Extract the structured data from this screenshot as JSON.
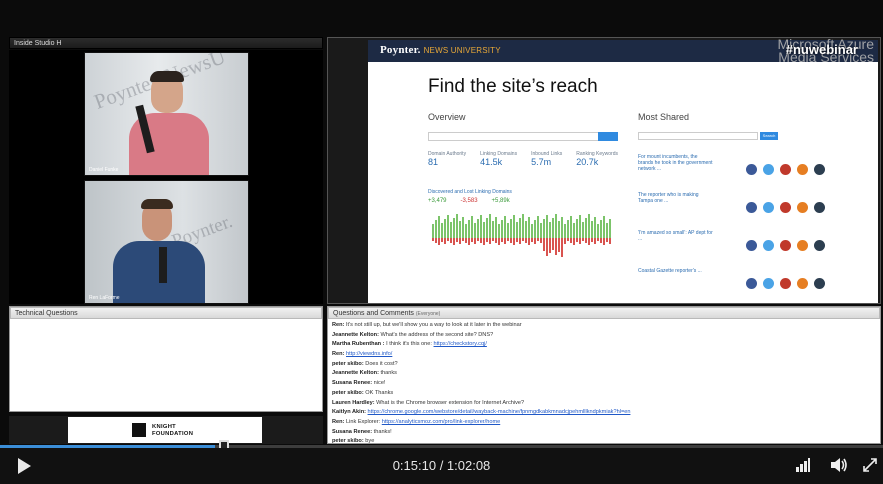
{
  "top_panel": {
    "title": "Inside Studio H"
  },
  "cams": [
    {
      "name": "Daniel Funke",
      "backdrop": "Poynter. NewsU"
    },
    {
      "name": "Ren LaForme",
      "backdrop": "Poynter."
    }
  ],
  "slide": {
    "brand": "Poynter.",
    "brand_sub": "NEWS UNIVERSITY",
    "title": "Find the site’s reach",
    "hashtag": "#nuwebinar",
    "watermark": "Microsoft Azure Media Services",
    "overview": {
      "heading": "Overview",
      "stats": [
        {
          "label": "Domain Authority",
          "value": "81"
        },
        {
          "label": "Linking Domains",
          "value": "41.5k"
        },
        {
          "label": "Inbound Links",
          "value": "5.7m"
        },
        {
          "label": "Ranking Keywords",
          "value": "20.7k"
        }
      ],
      "chart_title": "Discovered and Lost Linking Domains",
      "deltas": [
        "+3,479",
        "-3,583",
        "+5,89k"
      ]
    },
    "most_shared": {
      "heading": "Most Shared",
      "search_btn": "Search",
      "items": [
        "For mount incumbents, the brands he took in the government network ...",
        "The reporter who is making Tampa one ...",
        "'I'm amazed so small': AP dept for ...",
        "Coastal Gazette reporter's ..."
      ]
    }
  },
  "tech_panel": {
    "title": "Technical Questions"
  },
  "knight": {
    "line1": "KNIGHT",
    "line2": "FOUNDATION"
  },
  "questions_panel": {
    "title": "Questions and Comments",
    "filter": "(Everyone)",
    "messages": [
      {
        "author": "Ren:",
        "text": "It's not still up, but we'll show you a way to look at it later in the webinar",
        "link": ""
      },
      {
        "author": "Jeannette Kelton:",
        "text": "What's the address of the second site?  DNS?",
        "link": ""
      },
      {
        "author": "Martha Rubenthan :",
        "text": "I think it's this one:",
        "link": "https://checkstory.cqj/"
      },
      {
        "author": "Ren:",
        "text": "",
        "link": "http://viewdns.info/"
      },
      {
        "author": "peter skibo:",
        "text": "Does it cost?",
        "link": ""
      },
      {
        "author": "Jeannette Kelton:",
        "text": "thanks",
        "link": ""
      },
      {
        "author": "Susana Renee:",
        "text": "nice!",
        "link": ""
      },
      {
        "author": "peter skibo:",
        "text": "OK Thanks",
        "link": ""
      },
      {
        "author": "Lauren Hardley:",
        "text": "What is the Chrome browser extension for Internet Archive?",
        "link": ""
      },
      {
        "author": "Kaitlyn Akin:",
        "text": "",
        "link": "https://chrome.google.com/webstore/detail/wayback-machine/fpnmgdkabkmnadcjpehmlllkndpkmiak?hl=en"
      },
      {
        "author": "Ren:",
        "text": "Link Explorer:",
        "link": "https://analyticsmoz.com/pro/link-explorer/home"
      },
      {
        "author": "Susana Renee:",
        "text": "thanks!",
        "link": ""
      },
      {
        "author": "peter skibo:",
        "text": "bye",
        "link": ""
      }
    ]
  },
  "player": {
    "time": "0:15:10 / 1:02:08",
    "progress": 0.244,
    "accent": "#3b8ed8"
  }
}
